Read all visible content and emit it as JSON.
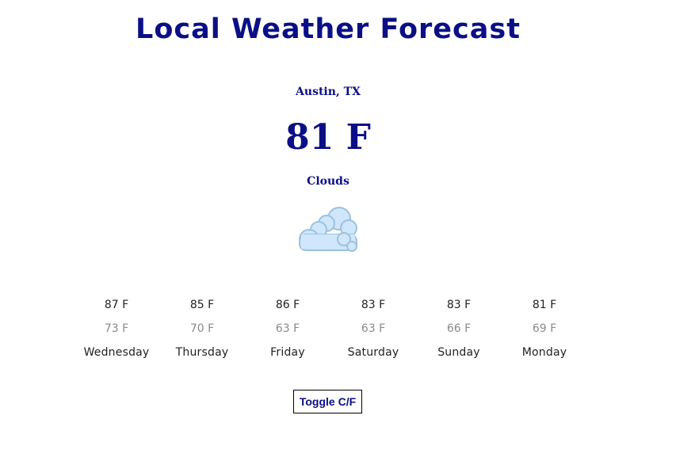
{
  "header": {
    "title": "Local Weather Forecast"
  },
  "current": {
    "location": "Austin, TX",
    "temperature": "81 F",
    "conditions": "Clouds",
    "icon": "cloud-icon"
  },
  "forecast": [
    {
      "high": "87 F",
      "low": "73 F",
      "day": "Wednesday"
    },
    {
      "high": "85 F",
      "low": "70 F",
      "day": "Thursday"
    },
    {
      "high": "86 F",
      "low": "63 F",
      "day": "Friday"
    },
    {
      "high": "83 F",
      "low": "63 F",
      "day": "Saturday"
    },
    {
      "high": "83 F",
      "low": "66 F",
      "day": "Sunday"
    },
    {
      "high": "81 F",
      "low": "69 F",
      "day": "Monday"
    }
  ],
  "controls": {
    "toggle_label": "Toggle C/F"
  },
  "colors": {
    "accent": "#0b0f86",
    "low_temp": "#8a8a8a",
    "text": "#222222"
  }
}
